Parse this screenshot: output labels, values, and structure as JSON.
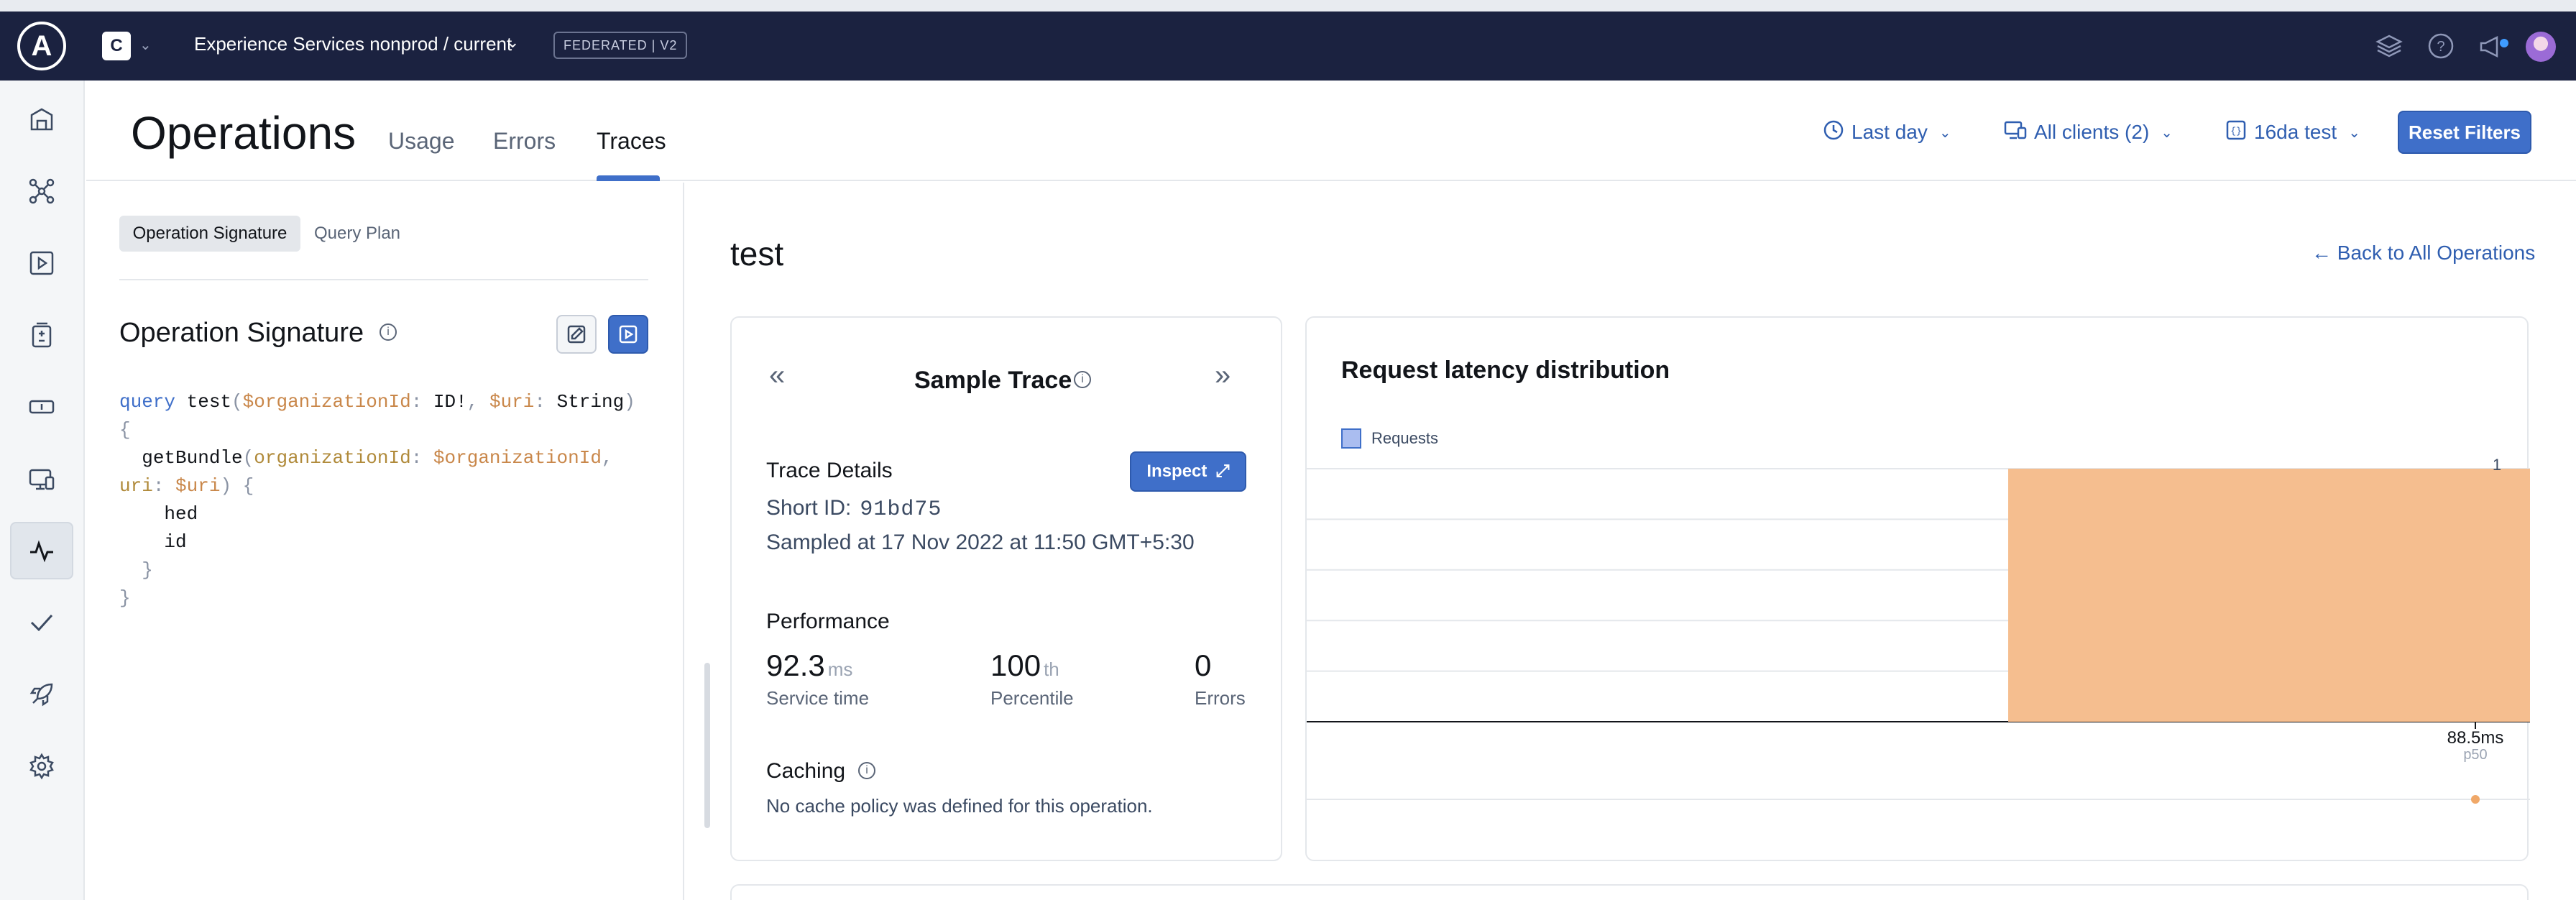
{
  "topbar": {
    "logo_letter": "A",
    "org_initial": "C",
    "graph_title": "Experience Services nonprod / current",
    "badge": "FEDERATED | V2"
  },
  "sidebar": {
    "items": [
      {
        "icon": "home-icon"
      },
      {
        "icon": "schema-graph-icon"
      },
      {
        "icon": "explorer-play-icon"
      },
      {
        "icon": "changelog-icon"
      },
      {
        "icon": "fields-icon"
      },
      {
        "icon": "clients-icon"
      },
      {
        "icon": "operations-chart-icon",
        "active": true
      },
      {
        "icon": "checks-icon"
      },
      {
        "icon": "launches-rocket-icon"
      },
      {
        "icon": "settings-gear-icon"
      }
    ]
  },
  "header": {
    "title": "Operations",
    "tabs": [
      {
        "label": "Usage"
      },
      {
        "label": "Errors"
      },
      {
        "label": "Traces",
        "active": true
      }
    ],
    "filters": {
      "time": "Last day",
      "clients": "All clients (2)",
      "operation": "16da test"
    },
    "reset_label": "Reset Filters"
  },
  "left_panel": {
    "segments": [
      {
        "label": "Operation Signature",
        "active": true
      },
      {
        "label": "Query Plan"
      }
    ],
    "section_title": "Operation Signature",
    "code": {
      "keyword": "query",
      "name": "test",
      "var1": "$organizationId",
      "type1": "ID!",
      "var2": "$uri",
      "type2": "String",
      "field": "getBundle",
      "arg1": "organizationId",
      "arg2": "uri",
      "subfields": [
        "hed",
        "id"
      ]
    }
  },
  "main": {
    "operation_name": "test",
    "back_link": "Back to All Operations",
    "sample_trace": {
      "title": "Sample Trace",
      "details_title": "Trace Details",
      "inspect_label": "Inspect",
      "short_id_label": "Short ID:",
      "short_id": "91bd75",
      "sampled_at": "Sampled at 17 Nov 2022 at 11:50 GMT+5:30",
      "performance_title": "Performance",
      "metrics": [
        {
          "value": "92.3",
          "unit": "ms",
          "label": "Service time"
        },
        {
          "value": "100",
          "unit": "th",
          "label": "Percentile"
        },
        {
          "value": "0",
          "unit": "",
          "label": "Errors"
        }
      ],
      "caching_title": "Caching",
      "caching_text": "No cache policy was defined for this operation."
    },
    "latency": {
      "title": "Request latency distribution",
      "legend": "Requests",
      "y_top_label": "1",
      "x_label": "88.5ms",
      "p_label": "p50"
    }
  },
  "chart_data": {
    "type": "bar",
    "title": "Request latency distribution",
    "series": [
      {
        "name": "Requests",
        "values": [
          1
        ]
      }
    ],
    "categories": [
      "88.5ms"
    ],
    "ylim": [
      0,
      1
    ],
    "annotations": [
      "p50"
    ],
    "legend": "top-left",
    "grid": true,
    "colors": {
      "bar": "#f5be8f",
      "legend": "#aabdf0",
      "marker": "#f0a868"
    }
  },
  "colors": {
    "topbar": "#1b2240",
    "accent": "#3f6fc9",
    "link": "#2f5eb0"
  }
}
